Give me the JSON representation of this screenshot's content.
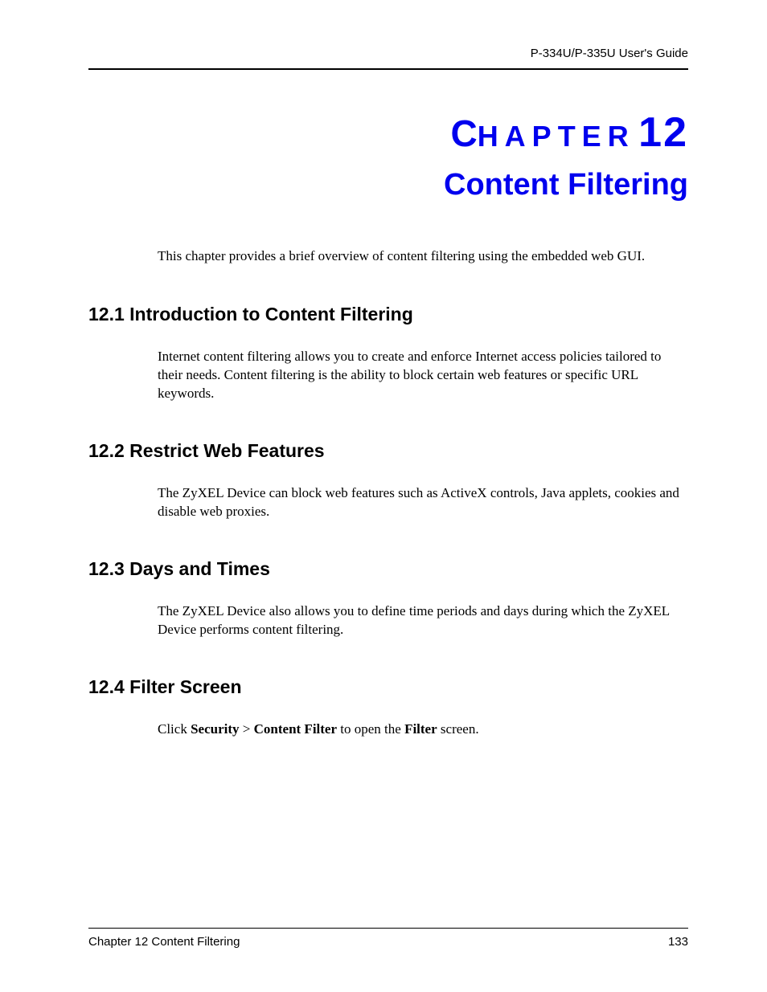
{
  "header": {
    "guide_title": "P-334U/P-335U User's Guide"
  },
  "chapter": {
    "label_first_letter": "C",
    "label_rest": "HAPTER",
    "number": "12",
    "title": "Content Filtering",
    "intro": "This chapter provides a brief overview of content filtering using the embedded web GUI."
  },
  "sections": [
    {
      "heading": "12.1  Introduction to Content Filtering",
      "body": "Internet content filtering allows you to create and enforce Internet access policies tailored to their needs. Content filtering is the ability to block certain web features or specific URL keywords."
    },
    {
      "heading": "12.2  Restrict Web Features",
      "body": "The ZyXEL Device can block web features such as ActiveX controls, Java applets, cookies and disable web proxies."
    },
    {
      "heading": "12.3  Days and Times",
      "body": "The ZyXEL Device also allows you to define time periods and days during which the ZyXEL Device performs content filtering."
    },
    {
      "heading": "12.4  Filter Screen"
    }
  ],
  "filter_screen": {
    "prefix": "Click ",
    "bold1": "Security",
    "mid1": " > ",
    "bold2": "Content Filter",
    "mid2": " to open the ",
    "bold3": "Filter",
    "suffix": " screen."
  },
  "footer": {
    "left": "Chapter 12 Content Filtering",
    "right": "133"
  }
}
